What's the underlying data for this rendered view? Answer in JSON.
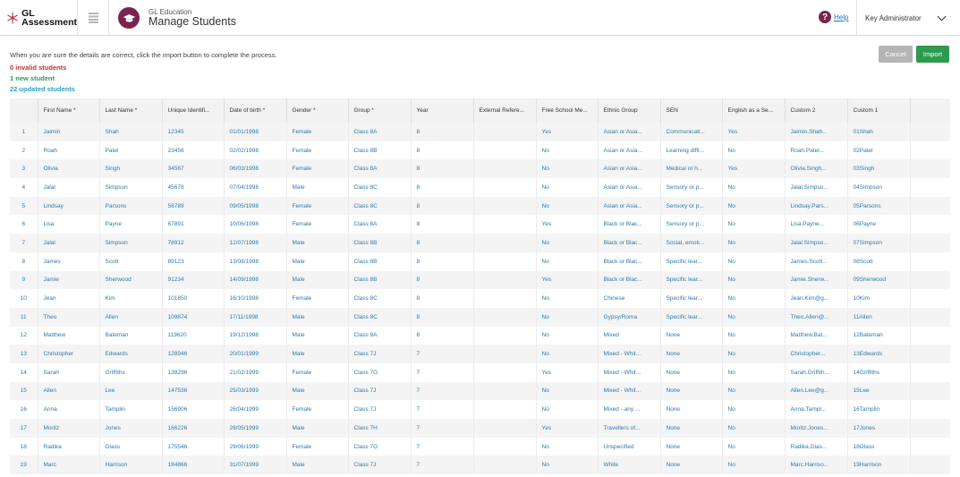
{
  "header": {
    "logo_line1": "GL",
    "logo_line2": "Assessment",
    "app_subtitle": "GL Education",
    "app_title": "Manage Students",
    "help_label": "Help",
    "user_name": "Key Administrator"
  },
  "instruction": "When you are sure the details are correct, click the import button to complete the process.",
  "stats": {
    "invalid": "0 invalid students",
    "new": "1 new student",
    "updated": "22 updated students"
  },
  "buttons": {
    "cancel": "Cancel",
    "import": "Import"
  },
  "colors": {
    "brand": "#7a2550",
    "import_button": "#2d9a4e",
    "cancel_button": "#b5b5b5",
    "invalid_text": "#c9302c",
    "new_text": "#2f9a5c",
    "updated_text": "#28a0c8",
    "cell_text": "#2e7aa8"
  },
  "icons": {
    "logo": "gl-logo-icon",
    "menu": "hamburger-menu-icon",
    "app": "graduation-cap-icon",
    "help": "question-mark-icon",
    "dropdown": "chevron-down-icon"
  },
  "table": {
    "columns": [
      "",
      "First Name *",
      "Last Name *",
      "Unique Identifi...",
      "Date of birth *",
      "Gender *",
      "Group *",
      "Year",
      "External Refere...",
      "Free School Me...",
      "Ethnic Group",
      "SEN",
      "English as a Se...",
      "Custom 2",
      "Custom 1",
      ""
    ],
    "rows": [
      [
        "1",
        "Jaimin",
        "Shah",
        "12345",
        "01/01/1998",
        "Female",
        "Class 8A",
        "8",
        "",
        "Yes",
        "Asian or Asia...",
        "Communicati...",
        "Yes",
        "Jaimin.Shah...",
        "01Shah",
        ""
      ],
      [
        "2",
        "Roah",
        "Patel",
        "23456",
        "02/02/1998",
        "Female",
        "Class 8B",
        "8",
        "",
        "No",
        "Asian or Asia...",
        "Learning diffi...",
        "No",
        "Roah.Patel...",
        "02Patel",
        ""
      ],
      [
        "3",
        "Olivia",
        "Singh",
        "34567",
        "06/03/1998",
        "Female",
        "Class 8A",
        "8",
        "",
        "No",
        "Asian or Asia...",
        "Medical or h...",
        "Yes",
        "Olivia.Singh...",
        "03Singh",
        ""
      ],
      [
        "4",
        "Jalal",
        "Simpson",
        "45678",
        "07/04/1998",
        "Male",
        "Class 8C",
        "8",
        "",
        "No",
        "Asian or Asia...",
        "Sensory or p...",
        "No",
        "Jalal.Simpso...",
        "04Simpson",
        ""
      ],
      [
        "5",
        "Lindsay",
        "Parsons",
        "56789",
        "09/05/1998",
        "Female",
        "Class 8C",
        "8",
        "",
        "No",
        "Asian or Asia...",
        "Sensory or p...",
        "No",
        "Lindsay.Pars...",
        "05Parsons",
        ""
      ],
      [
        "6",
        "Lisa",
        "Payne",
        "67891",
        "10/06/1998",
        "Female",
        "Class 8A",
        "8",
        "",
        "Yes",
        "Black or Blac...",
        "Sensory or p...",
        "No",
        "Lisa.Payne...",
        "06Payne",
        ""
      ],
      [
        "7",
        "Jalal",
        "Simpson",
        "78912",
        "12/07/1998",
        "Male",
        "Class 8B",
        "8",
        "",
        "No",
        "Black or Blac...",
        "Social, emoti...",
        "No",
        "Jalal.Simpso...",
        "07Simpson",
        ""
      ],
      [
        "8",
        "James",
        "Scott",
        "89123",
        "13/08/1998",
        "Male",
        "Class 8B",
        "8",
        "",
        "No",
        "Black or Blac...",
        "Specific lear...",
        "No",
        "James.Scott...",
        "08Scott",
        ""
      ],
      [
        "9",
        "Jamie",
        "Sherwood",
        "91234",
        "14/09/1998",
        "Male",
        "Class 8B",
        "8",
        "",
        "Yes",
        "Black or Blac...",
        "Specific lear...",
        "No",
        "Jamie.Sherw...",
        "09Sherwood",
        ""
      ],
      [
        "10",
        "Jean",
        "Kim",
        "101850",
        "16/10/1998",
        "Female",
        "Class 8C",
        "8",
        "",
        "No",
        "Chinese",
        "Specific lear...",
        "No",
        "Jean.Kim@g...",
        "10Kim",
        ""
      ],
      [
        "11",
        "Theo",
        "Allen",
        "109874",
        "17/11/1998",
        "Male",
        "Class 8C",
        "8",
        "",
        "No",
        "Gypsy/Roma",
        "Specific lear...",
        "No",
        "Theo.Allen@...",
        "11Allen",
        ""
      ],
      [
        "12",
        "Matthew",
        "Bateman",
        "119620",
        "19/12/1998",
        "Male",
        "Class 8A",
        "8",
        "",
        "No",
        "Mixed",
        "None",
        "No",
        "Matthew.Bat...",
        "12Bateman",
        ""
      ],
      [
        "13",
        "Christopher",
        "Edwards",
        "128946",
        "20/01/1999",
        "Male",
        "Class 7J",
        "7",
        "",
        "No",
        "Mixed - Whit...",
        "None",
        "No",
        "Christopher...",
        "13Edwards",
        ""
      ],
      [
        "14",
        "Sarah",
        "Griffiths",
        "138296",
        "21/02/1999",
        "Female",
        "Class 7G",
        "7",
        "",
        "Yes",
        "Mixed - Whit...",
        "None",
        "No",
        "Sarah.Griffith...",
        "14Griffiths",
        ""
      ],
      [
        "15",
        "Allen",
        "Lee",
        "147536",
        "25/03/1999",
        "Male",
        "Class 7J",
        "7",
        "",
        "No",
        "Mixed - Whit...",
        "None",
        "No",
        "Allen.Lee@g...",
        "15Lee",
        ""
      ],
      [
        "16",
        "Anna",
        "Tamplin",
        "156906",
        "26/04/1999",
        "Female",
        "Class 7J",
        "7",
        "",
        "No",
        "Mixed - any ...",
        "None",
        "No",
        "Anna.Tampl...",
        "16Tamplin",
        ""
      ],
      [
        "17",
        "Moritz",
        "Jones",
        "166226",
        "28/05/1999",
        "Male",
        "Class 7H",
        "7",
        "",
        "Yes",
        "Travellers of...",
        "None",
        "No",
        "Moritz.Jones...",
        "17Jones",
        ""
      ],
      [
        "18",
        "Radika",
        "Glass",
        "175546",
        "29/06/1999",
        "Female",
        "Class 7G",
        "7",
        "",
        "No",
        "Unspecified",
        "None",
        "No",
        "Radika.Glas...",
        "18Glass",
        ""
      ],
      [
        "19",
        "Marc",
        "Harrison",
        "184866",
        "31/07/1999",
        "Male",
        "Class 7J",
        "7",
        "",
        "No",
        "White",
        "None",
        "No",
        "Marc.Harriso...",
        "19Harrison",
        ""
      ]
    ]
  }
}
